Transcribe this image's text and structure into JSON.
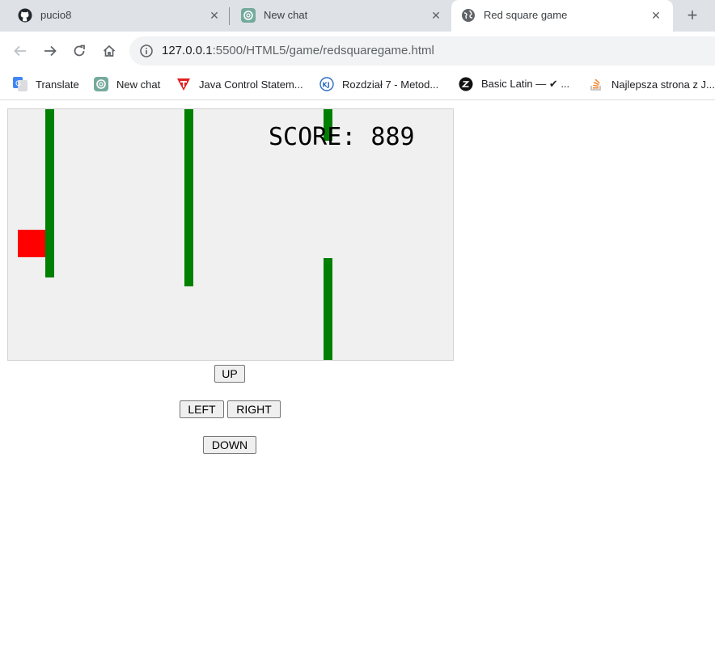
{
  "tabs": [
    {
      "title": "pucio8",
      "icon": "github-icon"
    },
    {
      "title": "New chat",
      "icon": "chatgpt-icon"
    },
    {
      "title": "Red square game",
      "icon": "globe-icon",
      "active": true
    }
  ],
  "toolbar": {
    "url_host": "127.0.0.1",
    "url_path": ":5500/HTML5/game/redsquaregame.html"
  },
  "bookmarks": [
    {
      "label": "Translate",
      "icon": "google-translate-icon"
    },
    {
      "label": "New chat",
      "icon": "chatgpt-icon"
    },
    {
      "label": "Java Control Statem...",
      "icon": "tpoint-icon"
    },
    {
      "label": "Rozdział 7 - Metod...",
      "icon": "kj-icon"
    },
    {
      "label": "Basic Latin — ✔ ...",
      "icon": "compart-icon"
    },
    {
      "label": "Najlepsza strona z J...",
      "icon": "stackoverflow-icon"
    }
  ],
  "game": {
    "score_text": "SCORE: 889",
    "colors": {
      "background": "#f0f0f0",
      "obstacle": "#008000",
      "player": "#ff0000"
    }
  },
  "controls": {
    "up": "UP",
    "left": "LEFT",
    "right": "RIGHT",
    "down": "DOWN"
  }
}
